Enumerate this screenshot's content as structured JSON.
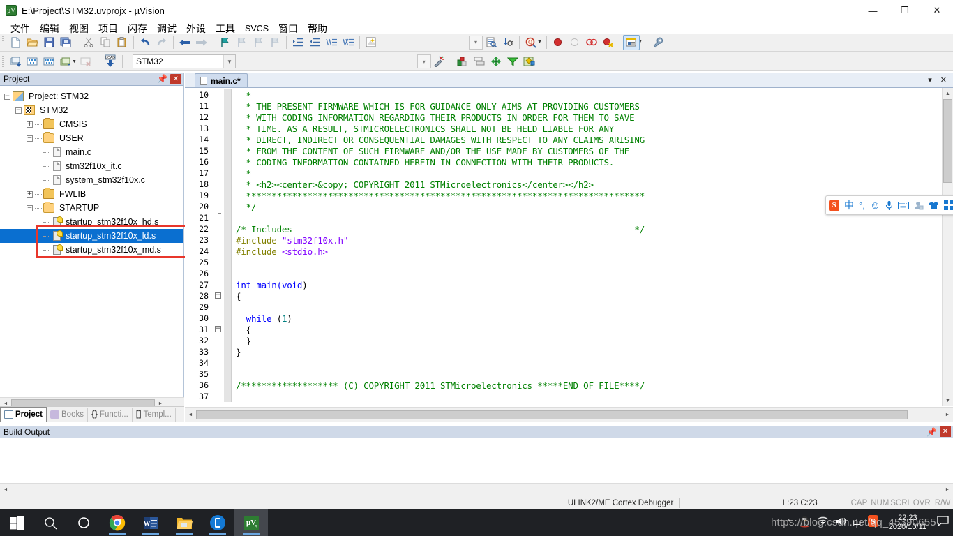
{
  "window": {
    "title": "E:\\Project\\STM32.uvprojx - µVision",
    "app_icon": "uvision-icon",
    "controls": {
      "minimize": "—",
      "maximize": "❐",
      "close": "✕"
    }
  },
  "menubar": {
    "items": [
      {
        "label": "文件",
        "name": "menu-file"
      },
      {
        "label": "编辑",
        "name": "menu-edit"
      },
      {
        "label": "视图",
        "name": "menu-view"
      },
      {
        "label": "项目",
        "name": "menu-project"
      },
      {
        "label": "闪存",
        "name": "menu-flash"
      },
      {
        "label": "调试",
        "name": "menu-debug"
      },
      {
        "label": "外设",
        "name": "menu-peripherals"
      },
      {
        "label": "工具",
        "name": "menu-tools"
      },
      {
        "label": "SVCS",
        "name": "menu-svcs"
      },
      {
        "label": "窗口",
        "name": "menu-window"
      },
      {
        "label": "帮助",
        "name": "menu-help"
      }
    ]
  },
  "toolbar_file": {
    "buttons": [
      {
        "name": "new-file-button",
        "icon": "new-file-icon",
        "glyph": "🗋"
      },
      {
        "name": "open-file-button",
        "icon": "open-folder-icon",
        "glyph": "📂"
      },
      {
        "name": "save-button",
        "icon": "save-disk-icon",
        "glyph": "💾"
      },
      {
        "name": "save-all-button",
        "icon": "save-all-icon",
        "glyph": "💾"
      },
      {
        "name": "cut-button",
        "icon": "scissors-icon",
        "glyph": "✂"
      },
      {
        "name": "copy-button",
        "icon": "copy-icon",
        "glyph": "⧉"
      },
      {
        "name": "paste-button",
        "icon": "clipboard-icon",
        "glyph": "📋"
      },
      {
        "name": "undo-button",
        "icon": "undo-arrow-icon",
        "glyph": "↶"
      },
      {
        "name": "redo-button",
        "icon": "redo-arrow-icon",
        "glyph": "↷"
      },
      {
        "name": "navigate-back-button",
        "icon": "arrow-left-icon",
        "glyph": "←"
      },
      {
        "name": "navigate-forward-button",
        "icon": "arrow-right-icon",
        "glyph": "→"
      },
      {
        "name": "toggle-bookmark-button",
        "icon": "bookmark-flag-icon",
        "glyph": "⚑"
      },
      {
        "name": "prev-bookmark-button",
        "icon": "bookmark-prev-icon",
        "glyph": "⚑"
      },
      {
        "name": "next-bookmark-button",
        "icon": "bookmark-next-icon",
        "glyph": "⚑"
      },
      {
        "name": "clear-bookmarks-button",
        "icon": "bookmark-clear-icon",
        "glyph": "⚑"
      },
      {
        "name": "indent-button",
        "icon": "indent-right-icon",
        "glyph": "≡"
      },
      {
        "name": "outdent-button",
        "icon": "indent-left-icon",
        "glyph": "≡"
      },
      {
        "name": "comment-button",
        "icon": "comment-lines-icon",
        "glyph": "//≡"
      },
      {
        "name": "uncomment-button",
        "icon": "uncomment-lines-icon",
        "glyph": "//≡"
      },
      {
        "name": "configuration-wizard-button",
        "icon": "wizard-icon",
        "glyph": "📝"
      }
    ],
    "right_buttons": [
      {
        "name": "bookmark-dropdown",
        "icon": "chevron-down-icon",
        "glyph": "▾"
      },
      {
        "name": "browse-symbols-button",
        "icon": "document-search-icon",
        "glyph": "📄"
      },
      {
        "name": "find-in-files-button",
        "icon": "binoculars-icon",
        "glyph": "🔍"
      },
      {
        "name": "find-button",
        "icon": "magnifier-q-icon",
        "glyph": "🔎"
      },
      {
        "name": "find-dropdown",
        "icon": "chevron-down-icon",
        "glyph": "▾"
      },
      {
        "name": "insert-breakpoint-button",
        "icon": "breakpoint-red-dot-icon",
        "glyph": "●"
      },
      {
        "name": "disable-breakpoint-button",
        "icon": "breakpoint-hollow-icon",
        "glyph": "○"
      },
      {
        "name": "disable-all-breakpoints-button",
        "icon": "breakpoints-pair-icon",
        "glyph": "⧉"
      },
      {
        "name": "kill-all-breakpoints-button",
        "icon": "breakpoint-delete-icon",
        "glyph": "●"
      },
      {
        "name": "manage-windows-button",
        "icon": "window-layout-icon",
        "glyph": "▤"
      },
      {
        "name": "manage-windows-dropdown",
        "icon": "chevron-down-icon",
        "glyph": "▾"
      },
      {
        "name": "options-button",
        "icon": "wrench-icon",
        "glyph": "🔧"
      }
    ]
  },
  "toolbar_build": {
    "buttons": [
      {
        "name": "translate-button",
        "icon": "translate-file-icon",
        "glyph": "⬇"
      },
      {
        "name": "build-button",
        "icon": "build-target-icon",
        "glyph": "⚙"
      },
      {
        "name": "rebuild-button",
        "icon": "rebuild-all-icon",
        "glyph": "⚙"
      },
      {
        "name": "batch-build-button",
        "icon": "batch-build-icon",
        "glyph": "⚙"
      },
      {
        "name": "batch-build-dropdown",
        "icon": "chevron-down-icon",
        "glyph": "▾"
      },
      {
        "name": "stop-build-button",
        "icon": "stop-build-icon",
        "glyph": "✕"
      },
      {
        "name": "download-button",
        "icon": "load-flash-icon",
        "glyph": "LOAD"
      }
    ],
    "target_selector": {
      "name": "target-combo",
      "value": "STM32"
    },
    "right_buttons": [
      {
        "name": "target-options-dropdown",
        "icon": "chevron-down-icon",
        "glyph": "▾"
      },
      {
        "name": "target-options-button",
        "icon": "magic-wand-icon",
        "glyph": "✨"
      },
      {
        "name": "manage-project-items-button",
        "icon": "project-items-icon",
        "glyph": "▣"
      },
      {
        "name": "manage-multi-project-button",
        "icon": "multi-project-icon",
        "glyph": "⧉"
      },
      {
        "name": "pack-installer-button",
        "icon": "pack-installer-icon",
        "glyph": "❖"
      },
      {
        "name": "manage-run-time-button",
        "icon": "run-time-env-icon",
        "glyph": "◆"
      },
      {
        "name": "select-software-packs-button",
        "icon": "software-packs-icon",
        "glyph": "◈"
      }
    ]
  },
  "project_panel": {
    "title": "Project",
    "pin_icon": "pin-icon",
    "close_icon": "close-icon",
    "tree": [
      {
        "indent": 0,
        "expander": "−",
        "icon": "project-root-icon",
        "label": "Project: STM32",
        "selected": false
      },
      {
        "indent": 1,
        "expander": "−",
        "icon": "target-icon",
        "label": "STM32",
        "selected": false
      },
      {
        "indent": 2,
        "expander": "+",
        "icon": "folder-closed-icon",
        "label": "CMSIS",
        "selected": false
      },
      {
        "indent": 2,
        "expander": "−",
        "icon": "folder-open-icon",
        "label": "USER",
        "selected": false
      },
      {
        "indent": 3,
        "expander": "",
        "icon": "c-file-icon",
        "label": "main.c",
        "selected": false
      },
      {
        "indent": 3,
        "expander": "",
        "icon": "c-file-icon",
        "label": "stm32f10x_it.c",
        "selected": false
      },
      {
        "indent": 3,
        "expander": "",
        "icon": "c-file-icon",
        "label": "system_stm32f10x.c",
        "selected": false
      },
      {
        "indent": 2,
        "expander": "+",
        "icon": "folder-closed-icon",
        "label": "FWLIB",
        "selected": false
      },
      {
        "indent": 2,
        "expander": "−",
        "icon": "folder-open-icon",
        "label": "STARTUP",
        "selected": false
      },
      {
        "indent": 3,
        "expander": "",
        "icon": "asm-file-icon",
        "label": "startup_stm32f10x_hd.s",
        "selected": false
      },
      {
        "indent": 3,
        "expander": "",
        "icon": "asm-file-icon",
        "label": "startup_stm32f10x_ld.s",
        "selected": true
      },
      {
        "indent": 3,
        "expander": "",
        "icon": "asm-file-icon",
        "label": "startup_stm32f10x_md.s",
        "selected": false
      }
    ],
    "highlight_color": "#e8362b",
    "selection_color": "#0a6fd0"
  },
  "dock_tabs": [
    {
      "label": "Project",
      "name": "tab-project",
      "icon": "project-tab-icon",
      "active": true
    },
    {
      "label": "Books",
      "name": "tab-books",
      "icon": "books-tab-icon",
      "active": false
    },
    {
      "label": "Functi...",
      "name": "tab-functions",
      "icon": "functions-tab-icon",
      "active": false
    },
    {
      "label": "Templ...",
      "name": "tab-templates",
      "icon": "templates-tab-icon",
      "active": false
    }
  ],
  "editor": {
    "tab": {
      "label": "main.c*",
      "icon": "c-file-icon"
    },
    "tab_controls": {
      "dropdown": "▾",
      "close": "✕"
    },
    "first_line": 10,
    "lines": [
      {
        "n": 10,
        "fold": "",
        "spans": [
          {
            "t": "  * ",
            "c": "c-cmt"
          }
        ]
      },
      {
        "n": 11,
        "fold": "",
        "spans": [
          {
            "t": "  * THE PRESENT FIRMWARE WHICH IS FOR GUIDANCE ONLY AIMS AT PROVIDING CUSTOMERS",
            "c": "c-cmt"
          }
        ]
      },
      {
        "n": 12,
        "fold": "",
        "spans": [
          {
            "t": "  * WITH CODING INFORMATION REGARDING THEIR PRODUCTS IN ORDER FOR THEM TO SAVE",
            "c": "c-cmt"
          }
        ]
      },
      {
        "n": 13,
        "fold": "",
        "spans": [
          {
            "t": "  * TIME. AS A RESULT, STMICROELECTRONICS SHALL NOT BE HELD LIABLE FOR ANY",
            "c": "c-cmt"
          }
        ]
      },
      {
        "n": 14,
        "fold": "",
        "spans": [
          {
            "t": "  * DIRECT, INDIRECT OR CONSEQUENTIAL DAMAGES WITH RESPECT TO ANY CLAIMS ARISING",
            "c": "c-cmt"
          }
        ]
      },
      {
        "n": 15,
        "fold": "",
        "spans": [
          {
            "t": "  * FROM THE CONTENT OF SUCH FIRMWARE AND/OR THE USE MADE BY CUSTOMERS OF THE",
            "c": "c-cmt"
          }
        ]
      },
      {
        "n": 16,
        "fold": "",
        "spans": [
          {
            "t": "  * CODING INFORMATION CONTAINED HEREIN IN CONNECTION WITH THEIR PRODUCTS.",
            "c": "c-cmt"
          }
        ]
      },
      {
        "n": 17,
        "fold": "",
        "spans": [
          {
            "t": "  *",
            "c": "c-cmt"
          }
        ]
      },
      {
        "n": 18,
        "fold": "",
        "spans": [
          {
            "t": "  * <h2><center>&copy; COPYRIGHT 2011 STMicroelectronics</center></h2>",
            "c": "c-cmt"
          }
        ]
      },
      {
        "n": 19,
        "fold": "",
        "spans": [
          {
            "t": "  ******************************************************************************",
            "c": "c-cmt"
          }
        ]
      },
      {
        "n": 20,
        "fold": "end",
        "spans": [
          {
            "t": "  */",
            "c": "c-cmt"
          }
        ]
      },
      {
        "n": 21,
        "fold": "",
        "spans": [
          {
            "t": "",
            "c": "c-txt"
          }
        ]
      },
      {
        "n": 22,
        "fold": "",
        "spans": [
          {
            "t": "/* Includes ------------------------------------------------------------------*/",
            "c": "c-cmt"
          }
        ]
      },
      {
        "n": 23,
        "fold": "",
        "spans": [
          {
            "t": "#include ",
            "c": "c-pp"
          },
          {
            "t": "\"stm32f10x.h\"",
            "c": "c-str"
          }
        ]
      },
      {
        "n": 24,
        "fold": "",
        "spans": [
          {
            "t": "#include ",
            "c": "c-pp"
          },
          {
            "t": "<stdio.h>",
            "c": "c-str"
          }
        ]
      },
      {
        "n": 25,
        "fold": "",
        "spans": [
          {
            "t": "",
            "c": "c-txt"
          }
        ]
      },
      {
        "n": 26,
        "fold": "",
        "spans": [
          {
            "t": "",
            "c": "c-txt"
          }
        ]
      },
      {
        "n": 27,
        "fold": "",
        "spans": [
          {
            "t": "int ",
            "c": "c-kw"
          },
          {
            "t": "main(",
            "c": "c-kw"
          },
          {
            "t": "void",
            "c": "c-kw"
          },
          {
            "t": ")",
            "c": "c-txt"
          }
        ]
      },
      {
        "n": 28,
        "fold": "open",
        "spans": [
          {
            "t": "{",
            "c": "c-txt"
          }
        ]
      },
      {
        "n": 29,
        "fold": "bar",
        "spans": [
          {
            "t": "",
            "c": "c-txt"
          }
        ]
      },
      {
        "n": 30,
        "fold": "bar",
        "spans": [
          {
            "t": "  ",
            "c": "c-txt"
          },
          {
            "t": "while",
            "c": "c-kw"
          },
          {
            "t": " (",
            "c": "c-txt"
          },
          {
            "t": "1",
            "c": "c-num"
          },
          {
            "t": ")",
            "c": "c-txt"
          }
        ]
      },
      {
        "n": 31,
        "fold": "open2",
        "spans": [
          {
            "t": "  {",
            "c": "c-txt"
          }
        ]
      },
      {
        "n": 32,
        "fold": "tick",
        "spans": [
          {
            "t": "  }",
            "c": "c-txt"
          }
        ]
      },
      {
        "n": 33,
        "fold": "bar",
        "spans": [
          {
            "t": "}",
            "c": "c-txt"
          }
        ]
      },
      {
        "n": 34,
        "fold": "",
        "spans": [
          {
            "t": "",
            "c": "c-txt"
          }
        ]
      },
      {
        "n": 35,
        "fold": "",
        "spans": [
          {
            "t": "",
            "c": "c-txt"
          }
        ]
      },
      {
        "n": 36,
        "fold": "",
        "spans": [
          {
            "t": "/******************* (C) COPYRIGHT 2011 STMicroelectronics *****END OF FILE****/",
            "c": "c-cmt"
          }
        ]
      },
      {
        "n": 37,
        "fold": "",
        "spans": [
          {
            "t": "",
            "c": "c-txt"
          }
        ]
      }
    ]
  },
  "build_output": {
    "title": "Build Output",
    "pin_icon": "pin-icon",
    "close_icon": "close-icon",
    "content": ""
  },
  "statusbar": {
    "debugger": "ULINK2/ME Cortex Debugger",
    "cursor": "L:23 C:23",
    "flags": [
      "CAP",
      "NUM",
      "SCRL",
      "OVR",
      "R/W"
    ]
  },
  "ime": {
    "logo": "S",
    "items": [
      {
        "name": "ime-mode-chinese",
        "glyph": "中"
      },
      {
        "name": "ime-punctuation-icon",
        "glyph": "°,"
      },
      {
        "name": "ime-emoji-icon",
        "glyph": "☺"
      },
      {
        "name": "ime-voice-input-icon",
        "glyph": "🎤"
      },
      {
        "name": "ime-soft-keyboard-icon",
        "glyph": "⌨"
      },
      {
        "name": "ime-user-icon",
        "glyph": "👤"
      },
      {
        "name": "ime-skin-icon",
        "glyph": "👕"
      },
      {
        "name": "ime-toolbox-icon",
        "glyph": "▦"
      }
    ]
  },
  "taskbar": {
    "items": [
      {
        "name": "start-button",
        "icon": "windows-logo-icon"
      },
      {
        "name": "search-button",
        "icon": "search-icon"
      },
      {
        "name": "task-view-button",
        "icon": "task-view-icon"
      },
      {
        "name": "chrome-taskbar-button",
        "icon": "chrome-icon",
        "running": true
      },
      {
        "name": "word-taskbar-button",
        "icon": "word-icon",
        "running": true
      },
      {
        "name": "explorer-taskbar-button",
        "icon": "file-explorer-icon",
        "running": true
      },
      {
        "name": "phone-link-taskbar-button",
        "icon": "phone-icon",
        "running": true
      },
      {
        "name": "uvision-taskbar-button",
        "icon": "uvision-icon",
        "running": true,
        "focused": true
      }
    ],
    "tray": {
      "overflow_icon": "chevron-up-icon",
      "qq_icon": "qq-penguin-icon",
      "network_icon": "wifi-icon",
      "volume_icon": "speaker-icon",
      "ime_icon": "ime-chinese-icon",
      "sogou_icon": "sogou-icon",
      "time": "22:23",
      "date": "2020/10/11",
      "notification_icon": "notification-icon"
    }
  },
  "watermark": {
    "text": "https://blog.csdn.net/qq_45390655"
  }
}
